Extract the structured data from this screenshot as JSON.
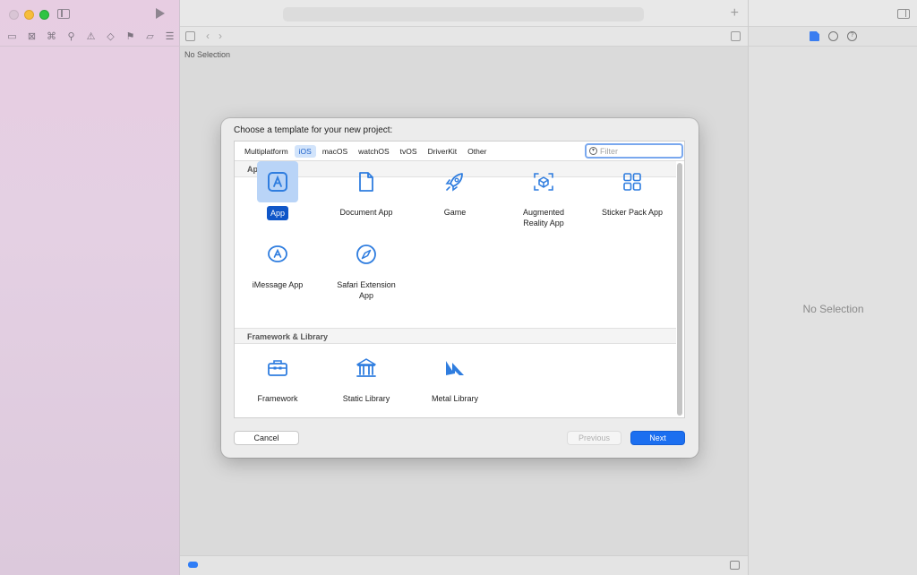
{
  "editor": {
    "no_selection": "No Selection"
  },
  "inspector": {
    "no_selection": "No Selection"
  },
  "sheet": {
    "title": "Choose a template for your new project:",
    "platform_tabs": [
      {
        "label": "Multiplatform"
      },
      {
        "label": "iOS",
        "active": true
      },
      {
        "label": "macOS"
      },
      {
        "label": "watchOS"
      },
      {
        "label": "tvOS"
      },
      {
        "label": "DriverKit"
      },
      {
        "label": "Other"
      }
    ],
    "filter": {
      "placeholder": "Filter",
      "value": ""
    },
    "sections": {
      "application": "Application",
      "framework_library": "Framework & Library"
    },
    "templates": {
      "app": {
        "label": "App",
        "icon": "app-store-icon",
        "selected": true
      },
      "document_app": {
        "label": "Document App",
        "icon": "document-icon"
      },
      "game": {
        "label": "Game",
        "icon": "rocket-icon"
      },
      "ar_app_line1": "Augmented",
      "ar_app_line2": "Reality App",
      "sticker_pack": {
        "label": "Sticker Pack App",
        "icon": "grid-icon"
      },
      "imessage": {
        "label": "iMessage App",
        "icon": "imessage-icon"
      },
      "safari_line1": "Safari Extension",
      "safari_line2": "App",
      "framework": {
        "label": "Framework",
        "icon": "toolbox-icon"
      },
      "static_library": {
        "label": "Static Library",
        "icon": "building-columns-icon"
      },
      "metal_library": {
        "label": "Metal Library",
        "icon": "metal-icon"
      }
    },
    "buttons": {
      "cancel": "Cancel",
      "previous": "Previous",
      "next": "Next"
    }
  },
  "colors": {
    "accent": "#1c6ff0",
    "selected_tile": "#b9d4f7",
    "icon_blue": "#2f7ddf"
  }
}
